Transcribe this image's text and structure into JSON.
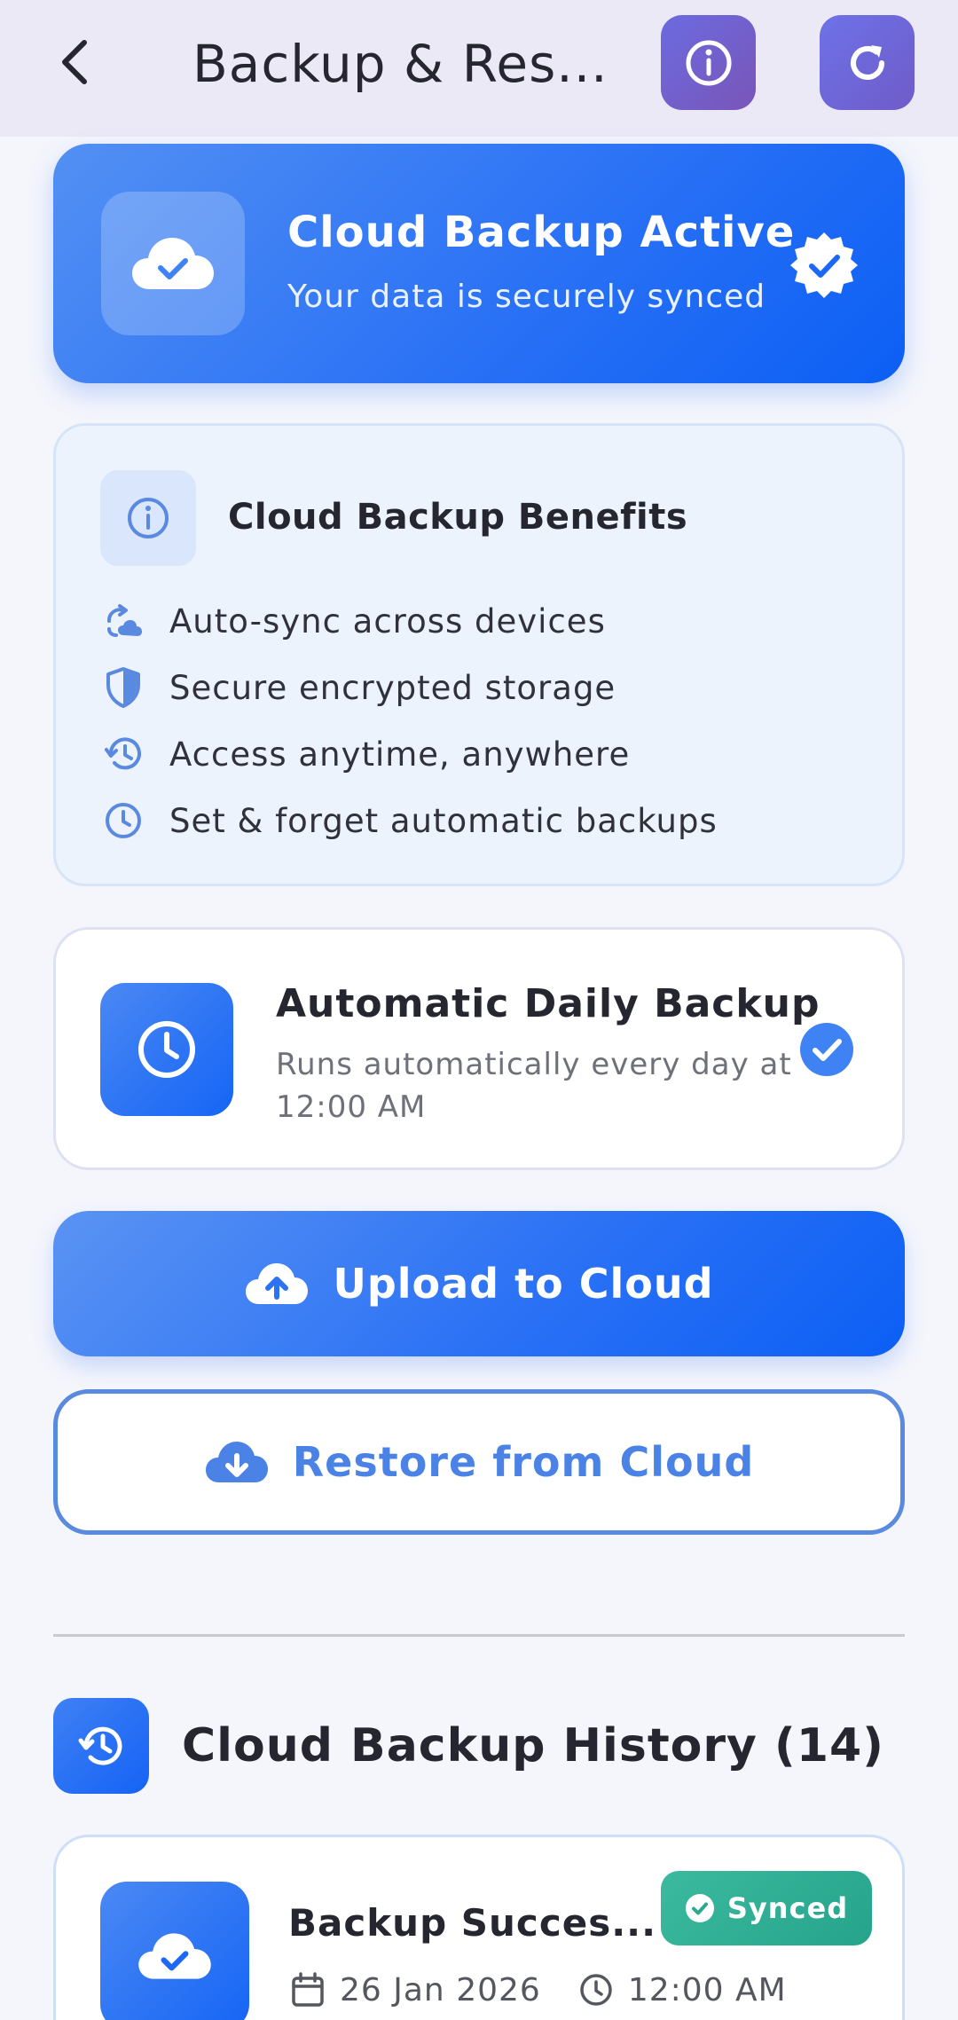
{
  "header": {
    "title": "Backup & Res...",
    "icons": {
      "back": "chevron-left-icon",
      "info": "info-icon",
      "refresh": "refresh-icon"
    }
  },
  "status": {
    "title": "Cloud Backup Active",
    "subtitle": "Your data is securely synced",
    "icons": {
      "main": "cloud-check-icon",
      "badge": "verified-badge-icon"
    }
  },
  "benefits": {
    "title": "Cloud Backup Benefits",
    "items": [
      {
        "icon": "sync-icon",
        "label": "Auto-sync across devices"
      },
      {
        "icon": "shield-icon",
        "label": "Secure encrypted storage"
      },
      {
        "icon": "history-icon",
        "label": "Access anytime, anywhere"
      },
      {
        "icon": "clock-icon",
        "label": "Set & forget automatic backups"
      }
    ]
  },
  "daily": {
    "title": "Automatic Daily Backup",
    "subtitle": "Runs automatically every day at 12:00 AM"
  },
  "actions": {
    "upload_label": "Upload to Cloud",
    "restore_label": "Restore from Cloud"
  },
  "history": {
    "title": "Cloud Backup History (14)",
    "items": [
      {
        "title": "Backup Succes...",
        "status": "Synced",
        "date": "26 Jan 2026",
        "time": "12:00 AM"
      }
    ]
  },
  "colors": {
    "accent": "#1565f5",
    "accent_light": "#5390f4",
    "header_bg": "#ece9f6",
    "purple": "#7a55b8",
    "synced": "#2aa98f",
    "outline": "#5a89e0"
  }
}
